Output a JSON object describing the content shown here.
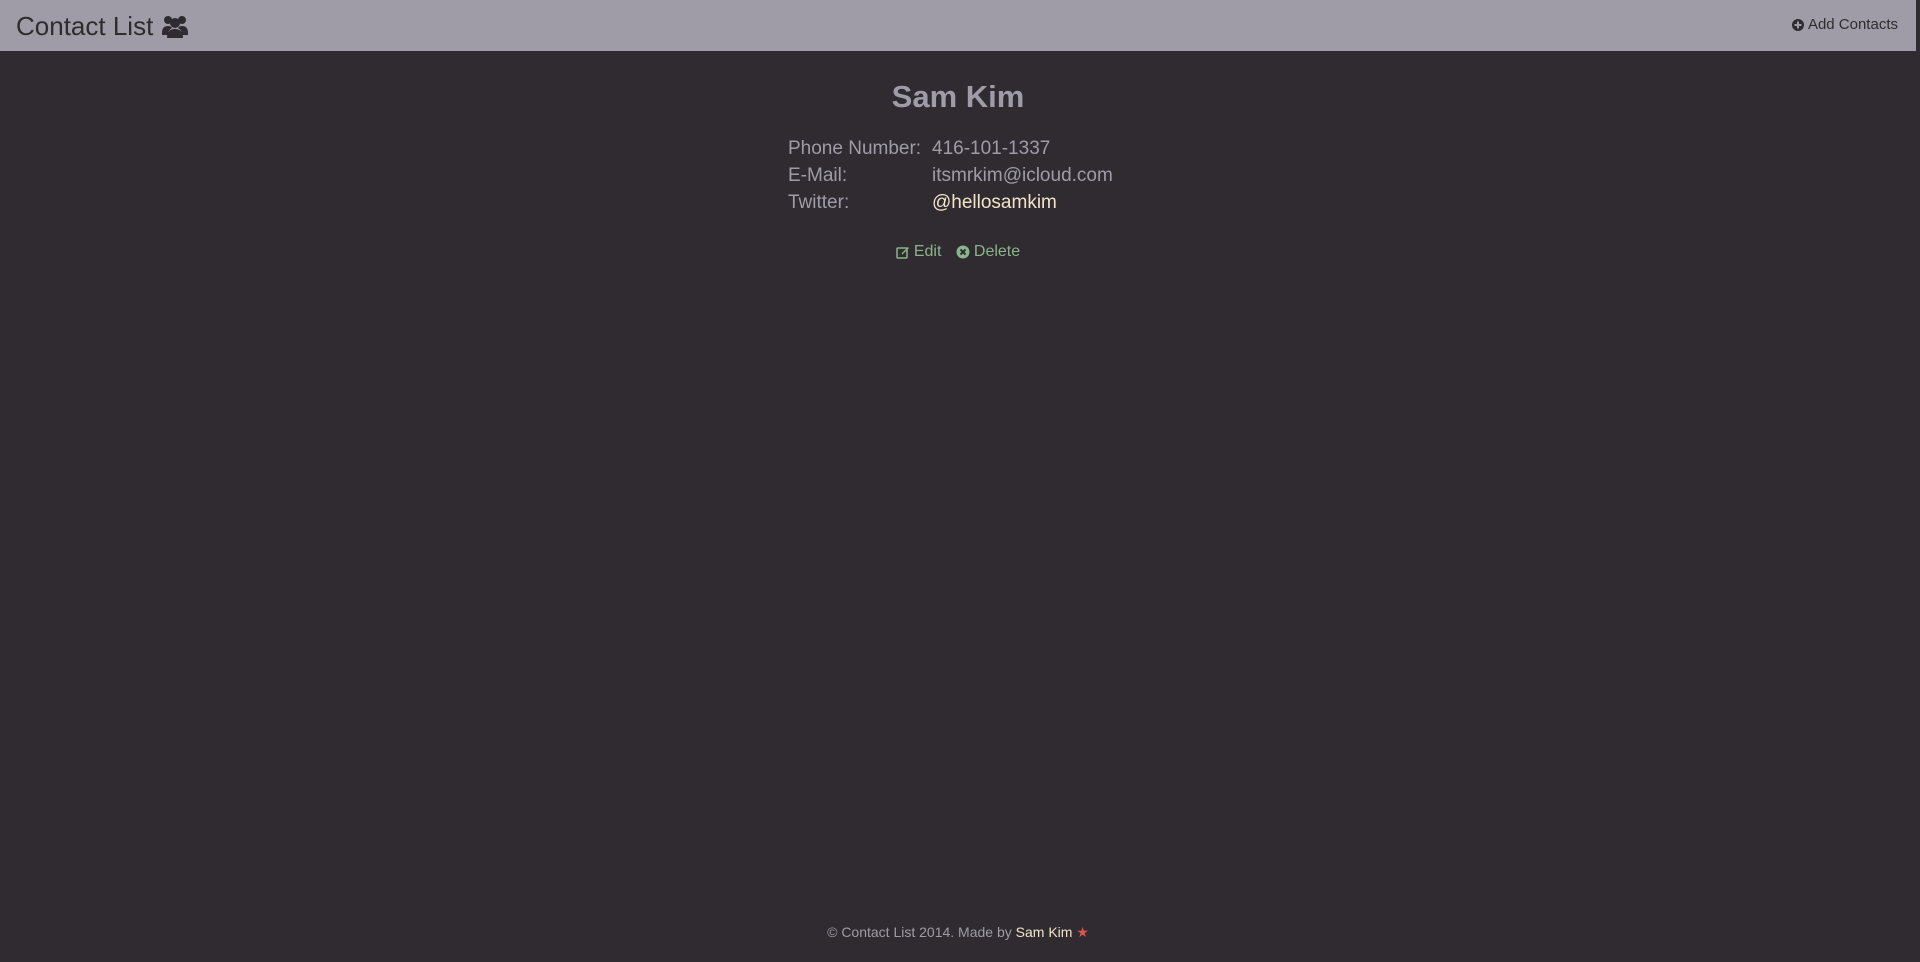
{
  "navbar": {
    "brand": "Contact List",
    "brand_icon": "users-icon",
    "add_label": "Add Contacts",
    "add_icon": "plus-circle-icon"
  },
  "contact": {
    "name": "Sam Kim",
    "fields": [
      {
        "label": "Phone Number:",
        "value": "416-101-1337"
      },
      {
        "label": "E-Mail:",
        "value": "itsmrkim@icloud.com"
      },
      {
        "label": "Twitter:",
        "value": "@hellosamkim"
      }
    ]
  },
  "actions": {
    "edit_label": "Edit",
    "edit_icon": "edit-icon",
    "delete_label": "Delete",
    "delete_icon": "times-circle-icon"
  },
  "footer": {
    "text": "© Contact List 2014. Made by",
    "author": "Sam Kim",
    "star": "★"
  },
  "colors": {
    "background": "#2f2b30",
    "navbar": "#a09ca7",
    "text": "#a09ca7",
    "link": "#8ab58a",
    "highlight": "#f1e4c8",
    "star": "#d9534f"
  }
}
